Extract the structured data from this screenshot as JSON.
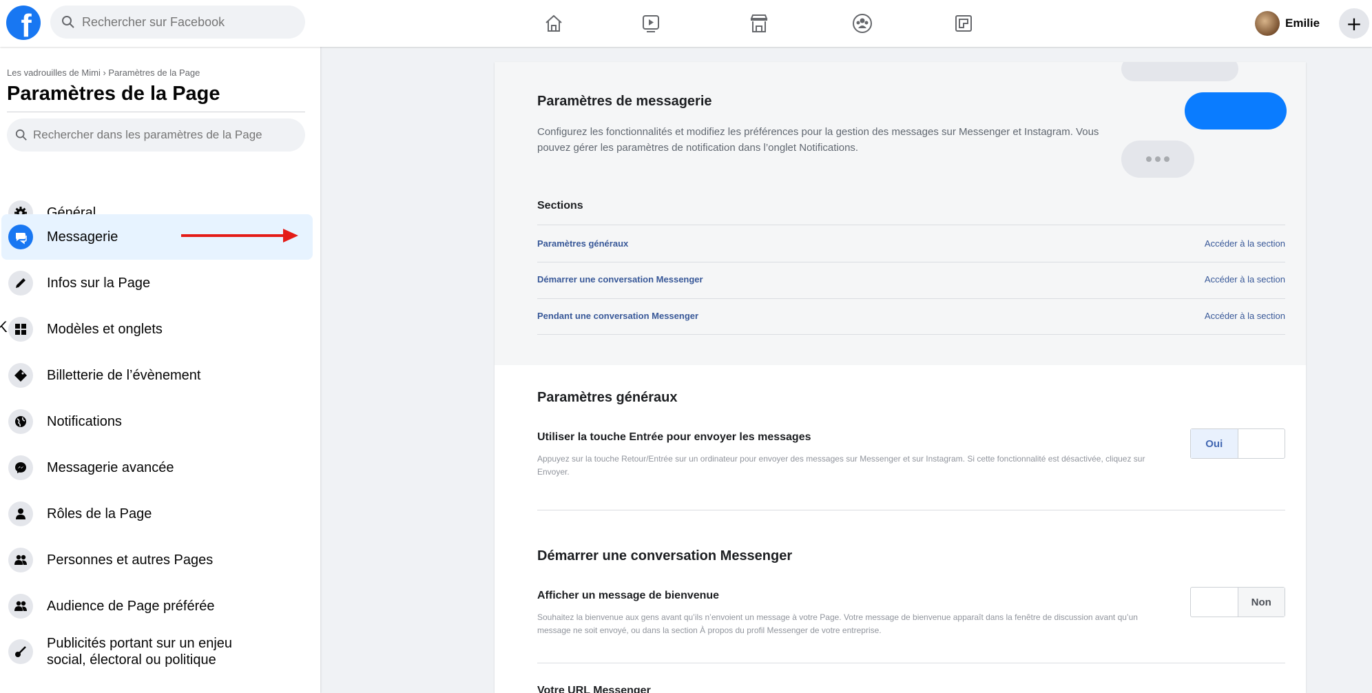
{
  "topbar": {
    "logo": "f",
    "search_placeholder": "Rechercher sur Facebook",
    "nav_icons": [
      "home-icon",
      "watch-icon",
      "marketplace-icon",
      "groups-icon",
      "gaming-icon"
    ],
    "user_name": "Emilie",
    "create_label": "+"
  },
  "sidebar": {
    "breadcrumb": "Les vadrouilles de Mimi › Paramètres de la Page",
    "title": "Paramètres de la Page",
    "search_placeholder": "Rechercher dans les paramètres de la Page",
    "edge_char": "K",
    "items": [
      {
        "label": "Général",
        "icon": "gear-icon"
      },
      {
        "label": "Messagerie",
        "icon": "messaging-icon",
        "active": true
      },
      {
        "label": "Infos sur la Page",
        "icon": "pencil-icon"
      },
      {
        "label": "Modèles et onglets",
        "icon": "grid-icon"
      },
      {
        "label": "Billetterie de l’évènement",
        "icon": "ticket-icon"
      },
      {
        "label": "Notifications",
        "icon": "globe-icon"
      },
      {
        "label": "Messagerie avancée",
        "icon": "messenger-icon"
      },
      {
        "label": "Rôles de la Page",
        "icon": "person-icon"
      },
      {
        "label": "Personnes et autres Pages",
        "icon": "people-icon"
      },
      {
        "label": "Audience de Page préférée",
        "icon": "audience-icon"
      },
      {
        "label": "Publicités portant sur un enjeu social, électoral ou politique",
        "icon": "guitar-icon"
      }
    ]
  },
  "main": {
    "messaging": {
      "title": "Paramètres de messagerie",
      "description": "Configurez les fonctionnalités et modifiez les préférences pour la gestion des messages sur Messenger et Instagram. Vous pouvez gérer les paramètres de notification dans l’onglet Notifications."
    },
    "sections": {
      "heading": "Sections",
      "access_label": "Accéder à la section",
      "links": [
        "Paramètres généraux",
        "Démarrer une conversation Messenger",
        "Pendant une conversation Messenger"
      ]
    },
    "general": {
      "title": "Paramètres généraux",
      "setting_title": "Utiliser la touche Entrée pour envoyer les messages",
      "setting_desc": "Appuyez sur la touche Retour/Entrée sur un ordinateur pour envoyer des messages sur Messenger et sur Instagram. Si cette fonctionnalité est désactivée, cliquez sur Envoyer.",
      "toggle_value": "Oui"
    },
    "start_conversation": {
      "title": "Démarrer une conversation Messenger",
      "setting_title": "Afficher un message de bienvenue",
      "setting_desc": "Souhaitez la bienvenue aux gens avant qu’ils n’envoient un message à votre Page. Votre message de bienvenue apparaît dans la fenêtre de discussion avant qu’un message ne soit envoyé, ou dans la section À propos du profil Messenger de votre entreprise.",
      "toggle_value": "Non",
      "next_setting_title": "Votre URL Messenger"
    }
  },
  "colors": {
    "brand": "#1877f2",
    "link": "#385898",
    "annotation_arrow": "#e41b17"
  }
}
